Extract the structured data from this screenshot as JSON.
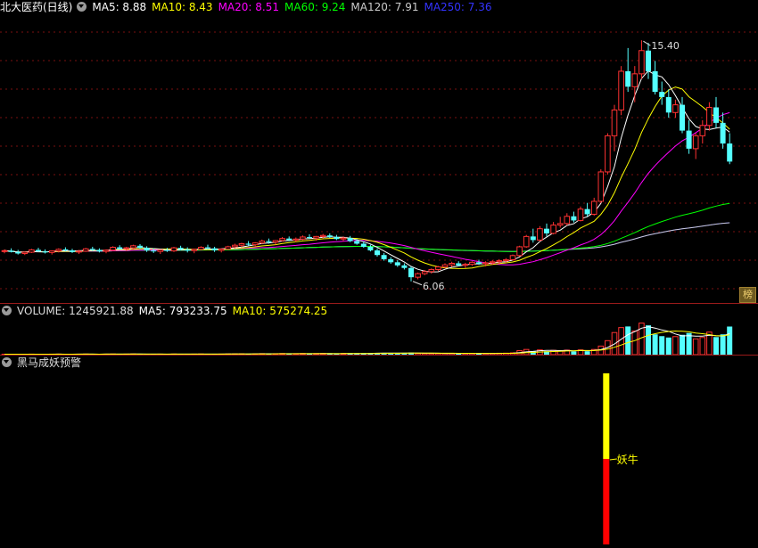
{
  "price_header": {
    "title": "北大医药(日线)",
    "ma5": "MA5: 8.88",
    "ma10": "MA10: 8.43",
    "ma20": "MA20: 8.51",
    "ma60": "MA60: 9.24",
    "ma120": "MA120: 7.91",
    "ma250": "MA250: 7.36"
  },
  "volume_header": {
    "volume": "VOLUME: 1245921.88",
    "ma5": "MA5: 793233.75",
    "ma10": "MA10: 575274.25"
  },
  "indicator_header": {
    "title": "黑马成妖预警"
  },
  "badge": "榜",
  "annotations": {
    "high": "15.40",
    "low": "6.06",
    "signal": "妖牛"
  },
  "colors": {
    "up": "#ff3232",
    "down": "#54ffff",
    "ma5": "#ffffff",
    "ma10": "#ffff00",
    "ma20": "#ff00ff",
    "ma60": "#00ff00",
    "ma120": "#cccccc",
    "ma250": "#0000ff",
    "grid": "#7a1010"
  },
  "chart_data": [
    {
      "type": "candlestick",
      "title": "北大医药(日线)",
      "ylim": [
        5.5,
        16.2
      ],
      "series": [
        {
          "name": "北大医药",
          "ohlc": [
            [
              7.22,
              7.3,
              7.15,
              7.25
            ],
            [
              7.25,
              7.34,
              7.18,
              7.2
            ],
            [
              7.2,
              7.28,
              7.1,
              7.14
            ],
            [
              7.14,
              7.22,
              7.08,
              7.19
            ],
            [
              7.19,
              7.32,
              7.16,
              7.28
            ],
            [
              7.28,
              7.36,
              7.2,
              7.22
            ],
            [
              7.22,
              7.3,
              7.14,
              7.18
            ],
            [
              7.18,
              7.26,
              7.1,
              7.24
            ],
            [
              7.24,
              7.34,
              7.18,
              7.3
            ],
            [
              7.3,
              7.38,
              7.22,
              7.26
            ],
            [
              7.26,
              7.32,
              7.16,
              7.2
            ],
            [
              7.2,
              7.28,
              7.12,
              7.23
            ],
            [
              7.23,
              7.36,
              7.2,
              7.32
            ],
            [
              7.32,
              7.4,
              7.24,
              7.28
            ],
            [
              7.28,
              7.34,
              7.18,
              7.22
            ],
            [
              7.22,
              7.3,
              7.15,
              7.27
            ],
            [
              7.27,
              7.42,
              7.24,
              7.38
            ],
            [
              7.38,
              7.46,
              7.28,
              7.32
            ],
            [
              7.32,
              7.4,
              7.24,
              7.36
            ],
            [
              7.36,
              7.48,
              7.3,
              7.44
            ],
            [
              7.44,
              7.5,
              7.32,
              7.36
            ],
            [
              7.36,
              7.42,
              7.2,
              7.26
            ],
            [
              7.26,
              7.34,
              7.16,
              7.22
            ],
            [
              7.22,
              7.3,
              7.12,
              7.28
            ],
            [
              7.28,
              7.36,
              7.2,
              7.24
            ],
            [
              7.24,
              7.4,
              7.2,
              7.36
            ],
            [
              7.36,
              7.44,
              7.26,
              7.3
            ],
            [
              7.3,
              7.38,
              7.18,
              7.25
            ],
            [
              7.25,
              7.33,
              7.15,
              7.3
            ],
            [
              7.3,
              7.42,
              7.26,
              7.38
            ],
            [
              7.38,
              7.48,
              7.3,
              7.34
            ],
            [
              7.34,
              7.4,
              7.2,
              7.26
            ],
            [
              7.26,
              7.34,
              7.18,
              7.31
            ],
            [
              7.31,
              7.44,
              7.28,
              7.4
            ],
            [
              7.4,
              7.52,
              7.34,
              7.46
            ],
            [
              7.46,
              7.56,
              7.38,
              7.52
            ],
            [
              7.52,
              7.62,
              7.44,
              7.48
            ],
            [
              7.48,
              7.58,
              7.4,
              7.55
            ],
            [
              7.55,
              7.68,
              7.5,
              7.62
            ],
            [
              7.62,
              7.72,
              7.52,
              7.58
            ],
            [
              7.58,
              7.66,
              7.48,
              7.64
            ],
            [
              7.64,
              7.78,
              7.6,
              7.72
            ],
            [
              7.72,
              7.8,
              7.62,
              7.66
            ],
            [
              7.66,
              7.76,
              7.58,
              7.7
            ],
            [
              7.7,
              7.84,
              7.66,
              7.78
            ],
            [
              7.78,
              7.88,
              7.7,
              7.74
            ],
            [
              7.74,
              7.82,
              7.64,
              7.8
            ],
            [
              7.8,
              7.9,
              7.72,
              7.84
            ],
            [
              7.84,
              7.92,
              7.74,
              7.78
            ],
            [
              7.78,
              7.86,
              7.66,
              7.7
            ],
            [
              7.7,
              7.8,
              7.62,
              7.74
            ],
            [
              7.74,
              7.82,
              7.58,
              7.62
            ],
            [
              7.62,
              7.7,
              7.48,
              7.52
            ],
            [
              7.52,
              7.6,
              7.36,
              7.4
            ],
            [
              7.4,
              7.48,
              7.22,
              7.26
            ],
            [
              7.26,
              7.34,
              7.02,
              7.08
            ],
            [
              7.08,
              7.16,
              6.86,
              6.92
            ],
            [
              6.92,
              7.0,
              6.74,
              6.8
            ],
            [
              6.8,
              6.88,
              6.62,
              6.68
            ],
            [
              6.68,
              6.76,
              6.52,
              6.58
            ],
            [
              6.58,
              6.64,
              6.06,
              6.22
            ],
            [
              6.22,
              6.4,
              6.14,
              6.36
            ],
            [
              6.36,
              6.5,
              6.3,
              6.44
            ],
            [
              6.44,
              6.56,
              6.36,
              6.52
            ],
            [
              6.52,
              6.66,
              6.46,
              6.62
            ],
            [
              6.62,
              6.76,
              6.56,
              6.7
            ],
            [
              6.7,
              6.82,
              6.62,
              6.76
            ],
            [
              6.76,
              6.84,
              6.64,
              6.68
            ],
            [
              6.68,
              6.78,
              6.58,
              6.72
            ],
            [
              6.72,
              6.84,
              6.66,
              6.8
            ],
            [
              6.8,
              6.9,
              6.7,
              6.74
            ],
            [
              6.74,
              6.84,
              6.64,
              6.78
            ],
            [
              6.78,
              6.88,
              6.7,
              6.82
            ],
            [
              6.82,
              6.92,
              6.74,
              6.86
            ],
            [
              6.86,
              6.96,
              6.78,
              6.9
            ],
            [
              6.9,
              7.1,
              6.86,
              7.06
            ],
            [
              7.06,
              7.44,
              7.02,
              7.4
            ],
            [
              7.4,
              7.86,
              7.36,
              7.8
            ],
            [
              7.8,
              8.1,
              7.56,
              7.66
            ],
            [
              7.66,
              8.2,
              7.6,
              8.1
            ],
            [
              8.1,
              8.3,
              7.8,
              7.92
            ],
            [
              7.92,
              8.36,
              7.88,
              8.24
            ],
            [
              8.24,
              8.56,
              8.14,
              8.3
            ],
            [
              8.3,
              8.7,
              8.22,
              8.58
            ],
            [
              8.58,
              8.76,
              8.34,
              8.42
            ],
            [
              8.42,
              8.96,
              8.38,
              8.86
            ],
            [
              8.86,
              9.1,
              8.58,
              8.66
            ],
            [
              8.66,
              9.3,
              8.6,
              9.16
            ],
            [
              9.16,
              10.4,
              9.1,
              10.3
            ],
            [
              10.3,
              11.8,
              10.2,
              11.7
            ],
            [
              11.7,
              12.9,
              11.1,
              12.7
            ],
            [
              12.7,
              14.4,
              12.5,
              14.2
            ],
            [
              14.2,
              15.1,
              13.4,
              13.6
            ],
            [
              13.6,
              14.4,
              13.0,
              14.1
            ],
            [
              14.1,
              15.4,
              13.9,
              15.0
            ],
            [
              15.0,
              15.3,
              13.9,
              14.2
            ],
            [
              14.2,
              14.6,
              13.3,
              13.4
            ],
            [
              13.4,
              13.8,
              12.9,
              13.2
            ],
            [
              13.2,
              13.5,
              12.4,
              12.6
            ],
            [
              12.6,
              13.1,
              12.4,
              12.9
            ],
            [
              12.9,
              13.2,
              11.8,
              11.9
            ],
            [
              11.9,
              12.3,
              11.0,
              11.2
            ],
            [
              11.2,
              11.8,
              10.8,
              11.7
            ],
            [
              11.7,
              12.3,
              11.4,
              12.1
            ],
            [
              12.1,
              13.0,
              11.9,
              12.8
            ],
            [
              12.8,
              13.2,
              12.0,
              12.2
            ],
            [
              12.2,
              12.6,
              11.2,
              11.4
            ],
            [
              11.4,
              11.8,
              10.6,
              10.7
            ]
          ]
        }
      ]
    },
    {
      "type": "bar",
      "title": "VOLUME",
      "ylim": [
        0,
        1700000
      ],
      "series": [
        {
          "name": "VOLUME",
          "values": [
            20000,
            18000,
            22000,
            19000,
            24000,
            21000,
            18000,
            23000,
            26000,
            20000,
            19000,
            22000,
            27000,
            21000,
            19000,
            23000,
            30000,
            22000,
            25000,
            31000,
            24000,
            21000,
            19000,
            23000,
            20000,
            28000,
            22000,
            19000,
            24000,
            30000,
            26000,
            22000,
            25000,
            33000,
            36000,
            40000,
            32000,
            37000,
            45000,
            38000,
            42000,
            50000,
            39000,
            43000,
            52000,
            41000,
            47000,
            55000,
            44000,
            40000,
            46000,
            52000,
            58000,
            62000,
            66000,
            70000,
            74000,
            68000,
            64000,
            60000,
            90000,
            58000,
            54000,
            52000,
            56000,
            60000,
            58000,
            50000,
            54000,
            58000,
            52000,
            56000,
            60000,
            62000,
            66000,
            80000,
            180000,
            230000,
            160000,
            210000,
            150000,
            190000,
            170000,
            200000,
            140000,
            210000,
            150000,
            230000,
            380000,
            620000,
            980000,
            1200000,
            1250000,
            1050000,
            1400000,
            1300000,
            900000,
            820000,
            760000,
            800000,
            880000,
            960000,
            700000,
            760000,
            1000000,
            780000,
            900000,
            1245921
          ]
        }
      ]
    },
    {
      "type": "bar",
      "title": "黑马成妖预警",
      "series": [
        {
          "name": "妖牛",
          "values": [
            1
          ]
        }
      ],
      "signal_index": 88
    }
  ]
}
